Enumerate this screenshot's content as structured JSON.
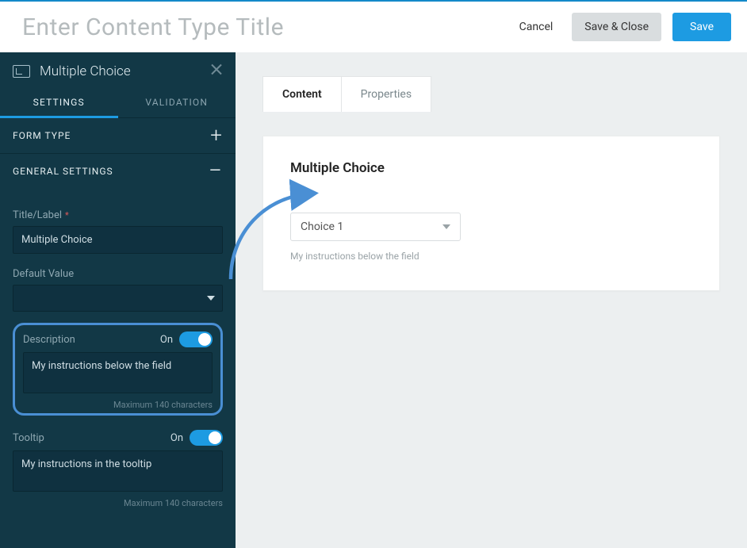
{
  "topbar": {
    "title_placeholder": "Enter Content Type Title",
    "cancel": "Cancel",
    "save_close": "Save & Close",
    "save": "Save"
  },
  "sidebar": {
    "head_title": "Multiple Choice",
    "tabs": {
      "settings": "SETTINGS",
      "validation": "VALIDATION"
    },
    "sections": {
      "form_type": "FORM TYPE",
      "general_settings": "GENERAL SETTINGS"
    },
    "fields": {
      "title_label": "Title/Label",
      "title_value": "Multiple Choice",
      "default_value_label": "Default Value",
      "default_value": "",
      "description_label": "Description",
      "description_value": "My instructions below the field",
      "tooltip_label": "Tooltip",
      "tooltip_value": "My instructions in the tooltip",
      "on_label": "On",
      "max_chars": "Maximum 140 characters"
    }
  },
  "content": {
    "tabs": {
      "content": "Content",
      "properties": "Properties"
    },
    "card": {
      "title": "Multiple Choice",
      "selected_choice": "Choice 1",
      "instructions": "My instructions below the field"
    }
  },
  "colors": {
    "accent": "#1d9be2",
    "sidebar": "#123846",
    "highlight": "#4a8fd4"
  }
}
